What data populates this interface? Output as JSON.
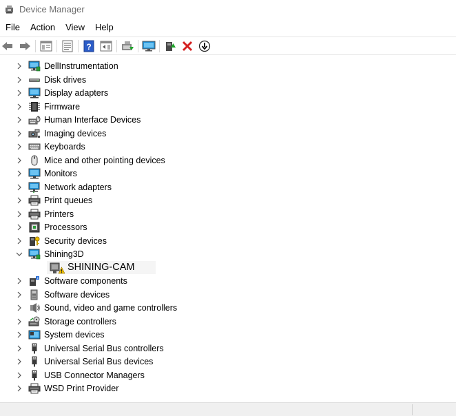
{
  "window": {
    "title": "Device Manager"
  },
  "menu": [
    "File",
    "Action",
    "View",
    "Help"
  ],
  "toolbar": {
    "buttons": [
      "back-icon",
      "forward-icon",
      "show-hide-tree-icon",
      "properties-icon",
      "help-icon",
      "action-pane-icon",
      "update-driver-icon",
      "display-icon",
      "enable-device-icon",
      "uninstall-icon",
      "disable-device-icon"
    ]
  },
  "tree": {
    "items": [
      {
        "label": "DellInstrumentation",
        "icon": "monitor-network-icon",
        "expanded": false
      },
      {
        "label": "Disk drives",
        "icon": "disk-drive-icon",
        "expanded": false
      },
      {
        "label": "Display adapters",
        "icon": "display-adapter-icon",
        "expanded": false
      },
      {
        "label": "Firmware",
        "icon": "firmware-chip-icon",
        "expanded": false
      },
      {
        "label": "Human Interface Devices",
        "icon": "hid-icon",
        "expanded": false
      },
      {
        "label": "Imaging devices",
        "icon": "camera-icon",
        "expanded": false
      },
      {
        "label": "Keyboards",
        "icon": "keyboard-icon",
        "expanded": false
      },
      {
        "label": "Mice and other pointing devices",
        "icon": "mouse-icon",
        "expanded": false
      },
      {
        "label": "Monitors",
        "icon": "monitor-icon",
        "expanded": false
      },
      {
        "label": "Network adapters",
        "icon": "network-adapter-icon",
        "expanded": false
      },
      {
        "label": "Print queues",
        "icon": "printer-icon",
        "expanded": false
      },
      {
        "label": "Printers",
        "icon": "printer-icon",
        "expanded": false
      },
      {
        "label": "Processors",
        "icon": "processor-icon",
        "expanded": false
      },
      {
        "label": "Security devices",
        "icon": "security-key-icon",
        "expanded": false
      },
      {
        "label": "Shining3D",
        "icon": "monitor-network-icon",
        "expanded": true,
        "children": [
          {
            "label": "SHINING-CAM",
            "icon": "warning-camera-icon"
          }
        ]
      },
      {
        "label": "Software components",
        "icon": "software-component-icon",
        "expanded": false
      },
      {
        "label": "Software devices",
        "icon": "software-device-icon",
        "expanded": false
      },
      {
        "label": "Sound, video and game controllers",
        "icon": "speaker-icon",
        "expanded": false
      },
      {
        "label": "Storage controllers",
        "icon": "storage-controller-icon",
        "expanded": false
      },
      {
        "label": "System devices",
        "icon": "system-folder-icon",
        "expanded": false
      },
      {
        "label": "Universal Serial Bus controllers",
        "icon": "usb-icon",
        "expanded": false
      },
      {
        "label": "Universal Serial Bus devices",
        "icon": "usb-icon",
        "expanded": false
      },
      {
        "label": "USB Connector Managers",
        "icon": "usb-icon",
        "expanded": false
      },
      {
        "label": "WSD Print Provider",
        "icon": "printer-icon",
        "expanded": false
      }
    ]
  },
  "colors": {
    "title_text": "#6b6b6b",
    "monitor_blue": "#1e8fd6",
    "delete_red": "#d42020",
    "help_blue": "#2b5cc8",
    "warning_yellow": "#f2c200"
  }
}
